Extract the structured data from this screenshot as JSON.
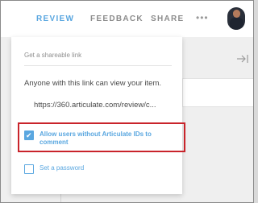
{
  "nav": {
    "review": "REVIEW",
    "feedback": "FEEDBACK",
    "share": "SHARE",
    "more": "•••"
  },
  "share_popover": {
    "section_title": "Get a shareable link",
    "description": "Anyone with this link can view your item.",
    "link_value": "https://360.articulate.com/review/c...",
    "allow_option": {
      "label_line1": "Allow users without Articulate IDs to",
      "label_line2": "comment",
      "checked": true
    },
    "password_option": {
      "label": "Set a password",
      "checked": false
    }
  },
  "colors": {
    "accent": "#5aa7e0",
    "highlight": "#c9242b"
  }
}
